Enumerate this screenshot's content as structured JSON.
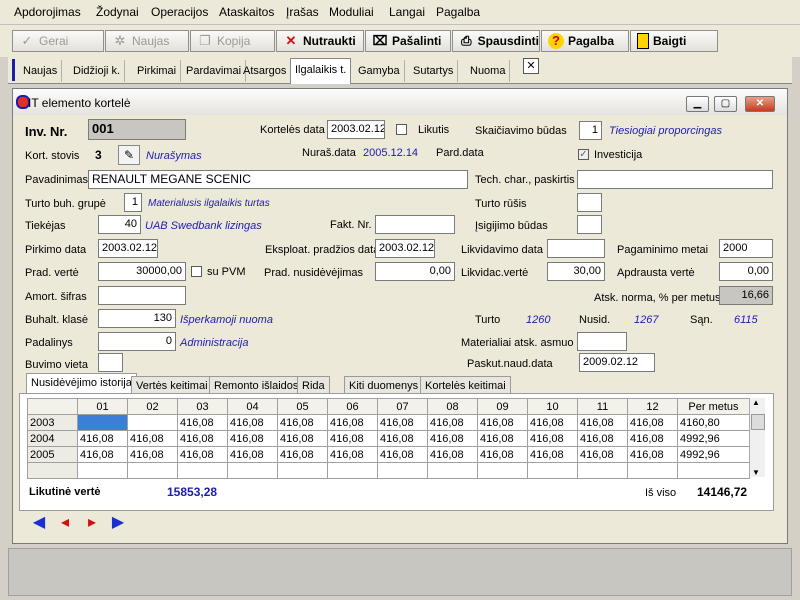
{
  "menubar": [
    "Apdorojimas",
    "Žodynai",
    "Operacijos",
    "Ataskaitos",
    "Įrašas",
    "Moduliai",
    "Langai",
    "Pagalba"
  ],
  "toolbar": {
    "gerai": "Gerai",
    "naujas": "Naujas",
    "kopija": "Kopija",
    "nutraukti": "Nutraukti",
    "pasalinti": "Pašalinti",
    "spausdinti": "Spausdinti",
    "pagalba": "Pagalba",
    "baigti": "Baigti"
  },
  "modules": [
    "Naujas",
    "Didžioji k.",
    "Pirkimai",
    "Pardavimai",
    "Atsargos",
    "Ilgalaikis t.",
    "Gamyba",
    "Sutartys",
    "Nuoma"
  ],
  "module_close": "✕",
  "window": {
    "title": "IT elemento kortelė"
  },
  "form": {
    "inv_nr_label": "Inv. Nr.",
    "inv_nr": "001",
    "kort_data_label": "Kortelės data",
    "kort_data": "2003.02.12",
    "likutis_label": "Likutis",
    "skaic_label": "Skaičiavimo būdas",
    "skaic_code": "1",
    "skaic_name": "Tiesiogiai proporcingas",
    "stovis_label": "Kort. stovis",
    "stovis_code": "3",
    "stovis_name": "Nurašymas",
    "nuras_label": "Nuraš.data",
    "nuras_data": "2005.12.14",
    "pard_label": "Pard.data",
    "investicija_label": "Investicija",
    "pavad_label": "Pavadinimas",
    "pavad": "RENAULT MEGANE SCENIC",
    "tech_label": "Tech. char., paskirtis",
    "grupe_label": "Turto buh. grupė",
    "grupe_code": "1",
    "grupe_name": "Materialusis ilgalaikis turtas",
    "rusis_label": "Turto rūšis",
    "tiekejas_label": "Tiekėjas",
    "tiekejas_code": "40",
    "tiekejas_name": "UAB Swedbank lizingas",
    "fakt_label": "Fakt. Nr.",
    "isig_label": "Įsigijimo būdas",
    "pirk_label": "Pirkimo data",
    "pirk_data": "2003.02.12",
    "eksp_label": "Eksploat. pradžios data",
    "eksp_data": "2003.02.12",
    "likv_label": "Likvidavimo data",
    "pagam_label": "Pagaminimo metai",
    "pagam": "2000",
    "prad_verte_label": "Prad. vertė",
    "prad_verte": "30000,00",
    "supvm_label": "su PVM",
    "prad_nus_label": "Prad. nusidėvėjimas",
    "prad_nus": "0,00",
    "likvidac_label": "Likvidac.vertė",
    "likvidac": "30,00",
    "apdr_label": "Apdrausta vertė",
    "apdr": "0,00",
    "amort_label": "Amort. šifras",
    "norma_label": "Atsk. norma, % per metus",
    "norma": "16,66",
    "buhalt_label": "Buhalt. klasė",
    "buhalt_code": "130",
    "buhalt_name": "Išperkamoji nuoma",
    "turto_label": "Turto",
    "turto": "1260",
    "nusid_label": "Nusid.",
    "nusid": "1267",
    "san_label": "Sąn.",
    "san": "6115",
    "padal_label": "Padalinys",
    "padal_code": "0",
    "padal_name": "Administracija",
    "asmuo_label": "Materialiai atsk. asmuo",
    "buvimo_label": "Buvimo vieta",
    "paskut_label": "Paskut.naud.data",
    "paskut": "2009.02.12"
  },
  "inner_tabs": [
    "Nusidėvėjimo istorija",
    "Vertės keitimai",
    "Remonto išlaidos",
    "Rida",
    "Kiti duomenys",
    "Kortelės keitimai"
  ],
  "grid": {
    "headers": [
      "",
      "01",
      "02",
      "03",
      "04",
      "05",
      "06",
      "07",
      "08",
      "09",
      "10",
      "11",
      "12",
      "Per metus"
    ],
    "rows": [
      [
        "2003",
        "",
        "",
        "416,08",
        "416,08",
        "416,08",
        "416,08",
        "416,08",
        "416,08",
        "416,08",
        "416,08",
        "416,08",
        "416,08",
        "4160,80"
      ],
      [
        "2004",
        "416,08",
        "416,08",
        "416,08",
        "416,08",
        "416,08",
        "416,08",
        "416,08",
        "416,08",
        "416,08",
        "416,08",
        "416,08",
        "416,08",
        "4992,96"
      ],
      [
        "2005",
        "416,08",
        "416,08",
        "416,08",
        "416,08",
        "416,08",
        "416,08",
        "416,08",
        "416,08",
        "416,08",
        "416,08",
        "416,08",
        "416,08",
        "4992,96"
      ],
      [
        "",
        "",
        "",
        "",
        "",
        "",
        "",
        "",
        "",
        "",
        "",
        "",
        "",
        ""
      ]
    ]
  },
  "totals": {
    "likutine_label": "Likutinė vertė",
    "likutine": "15853,28",
    "isviso_label": "Iš viso",
    "isviso": "14146,72"
  },
  "colors": {
    "accent_blue": "#1c1cae",
    "nav_blue": "#1a2fd0",
    "close_red": "#c63a1c"
  }
}
